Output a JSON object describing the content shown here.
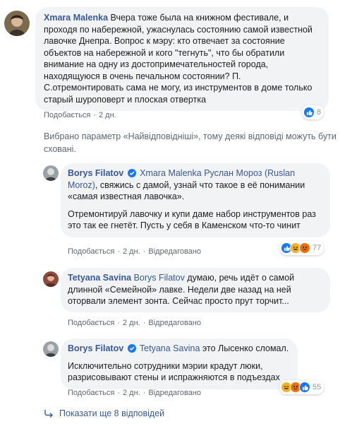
{
  "comment1": {
    "author": "Xmara Malenka",
    "text": "Вчера тоже была на книжном фестивале, и проходя по набережной, ужаснулась состоянию самой известной лавочке Днепра. Вопрос к мэру: кто отвечает за состояние объектов на набережной и кого \"тегнуть\", что бы обратили внимание на одну из достопримечательностей города, находящуюся в очень печальном состоянии? П. С.отремонтировать сама не могу, из инструментов в доме только старый шуроповерт и плоская отвертка",
    "like_label": "Подобається",
    "time": "2 дн.",
    "reaction_count": "8"
  },
  "filter_notice": "Вибрано параметр «Найвідповідніші», тому деякі відповіді можуть бути сховані.",
  "reply1": {
    "author": "Borys Filatov",
    "tags": [
      "Xmara Malenka",
      "Руслан Мороз (Ruslan Moroz)"
    ],
    "text_part1": ", свяжись с дамой, узнай что такое в её понимании «самая известная лавочка».",
    "text_part2": "Отремонтируй лавочку и купи даме набор инструментов раз это так ее гнетёт. Пусть у себя в Каменском что-то чинит",
    "like_label": "Подобається",
    "time": "2 дн.",
    "edited_label": "Відредаговано",
    "reaction_count": "77"
  },
  "reply2": {
    "author": "Tetyana Savina",
    "tag": "Borys Filatov",
    "text": "думаю, речь идёт о самой длинной «Семейной» лавке. Недели две назад на ней оторвали элемент зонта. Сейчас просто прут торчит...",
    "like_label": "Подобається",
    "time": "2 дн.",
    "edited_label": "Відредаговано"
  },
  "reply3": {
    "author": "Borys Filatov",
    "tag": "Tetyana Savina",
    "text_part1": "это Лысенко сломал.",
    "text_part2": "Исключительно сотрудники мэрии крадут люки, разрисовывают стены и испражняются в подъездах",
    "like_label": "Подобається",
    "time": "2 дн.",
    "edited_label": "Відредаговано",
    "reaction_count": "55"
  },
  "show_more_label": "Показати ще 8 відповідей",
  "icons": {
    "reply_arrow": "reply-arrow-icon",
    "verified": "verified-badge-icon",
    "like": "like-reaction-icon",
    "haha": "haha-reaction-icon",
    "angry": "angry-reaction-icon"
  },
  "colors": {
    "link": "#385898",
    "bubble": "#f2f3f5",
    "meta": "#606770",
    "like": "#1877f2"
  }
}
